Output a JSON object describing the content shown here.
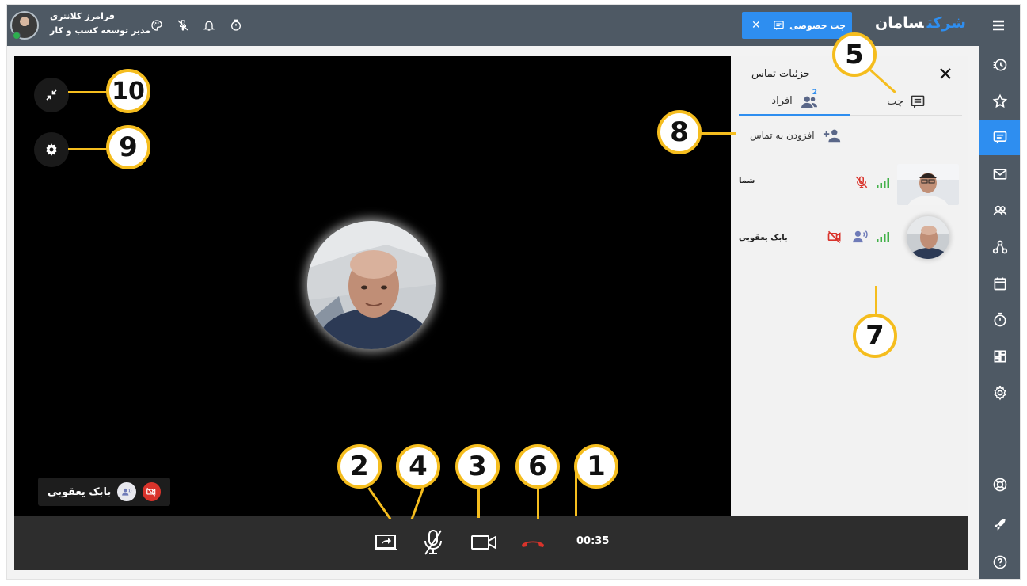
{
  "topbar": {
    "user_name": "فرامرز کلانتری",
    "user_role": "مدیر توسعه کسب و کار",
    "icons": [
      "palette-icon",
      "pin-off-icon",
      "bell-icon",
      "timer-icon"
    ],
    "chat_chip_label": "چت خصوصی",
    "brand_part1": "شرکت",
    "brand_part2": "سامان"
  },
  "sidebar": {
    "items": [
      "history-icon",
      "star-icon",
      "chat-icon",
      "mail-icon",
      "groups-icon",
      "org-chart-icon",
      "calendar-icon",
      "timer-icon",
      "dashboard-icon",
      "settings-icon",
      "support-icon",
      "rocket-icon",
      "help-icon"
    ],
    "active": "chat-icon"
  },
  "video": {
    "participant_name": "بابک یعقوبی"
  },
  "controls": {
    "timer": "00:35",
    "buttons": [
      "share-screen",
      "mute-mic",
      "camera",
      "end-call"
    ]
  },
  "panel": {
    "title": "جزئیات تماس",
    "tab_chat": "چت",
    "tab_people": "افراد",
    "people_count": "2",
    "add_label": "افزودن به تماس",
    "participants": [
      {
        "name": "شما"
      },
      {
        "name": "بابک یعقوبی"
      }
    ]
  },
  "callouts": {
    "c1": "1",
    "c2": "2",
    "c3": "3",
    "c4": "4",
    "c5": "5",
    "c6": "6",
    "c7": "7",
    "c8": "8",
    "c9": "9",
    "c10": "10"
  },
  "colors": {
    "topbar": "#4e5964",
    "accent": "#2e8ef0",
    "callout": "#f5bd1e",
    "end_call": "#d9332b"
  }
}
